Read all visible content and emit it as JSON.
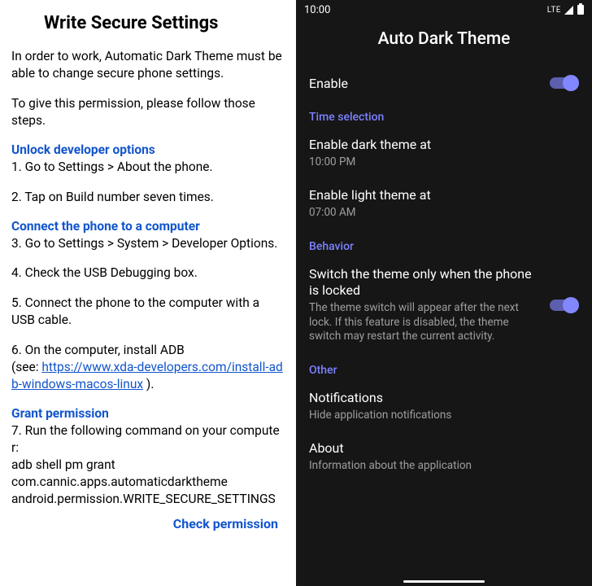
{
  "left": {
    "title": "Write Secure Settings",
    "intro1": "In order to work, Automatic Dark Theme must be able to change secure phone settings.",
    "intro2": "To give this permission, please follow those steps.",
    "heading1": "Unlock developer options",
    "step1": "1. Go to Settings > About the phone.",
    "step2": "2. Tap on Build number seven times.",
    "heading2": "Connect the phone to a computer",
    "step3": "3. Go to Settings > System > Developer Options.",
    "step4": "4. Check the USB Debugging box.",
    "step5": "5. Connect the phone to the computer with a USB cable.",
    "step6_pre": "6. On the computer, install ADB",
    "step6_see": "(see: ",
    "step6_link": "https://www.xda-developers.com/install-adb-windows-macos-linux",
    "step6_post": " ).",
    "heading3": "Grant permission",
    "step7_line1": "7. Run the following command on your computer:",
    "step7_cmd1": "adb shell pm grant",
    "step7_cmd2": "com.cannic.apps.automaticdarktheme",
    "step7_cmd3": "android.permission.WRITE_SECURE_SETTINGS",
    "check_permission": "Check permission"
  },
  "right": {
    "status": {
      "time": "10:00",
      "lte": "LTE"
    },
    "title": "Auto Dark Theme",
    "enable_label": "Enable",
    "section_time": "Time selection",
    "dark_title": "Enable dark theme at",
    "dark_time": "10:00 PM",
    "light_title": "Enable light theme at",
    "light_time": "07:00 AM",
    "section_behavior": "Behavior",
    "behavior_title": "Switch the theme only when the phone is locked",
    "behavior_sub": "The theme switch will appear after the next lock. If this feature is disabled, the theme switch may restart the current activity.",
    "section_other": "Other",
    "notifications_title": "Notifications",
    "notifications_sub": "Hide application notifications",
    "about_title": "About",
    "about_sub": "Information about the application"
  }
}
